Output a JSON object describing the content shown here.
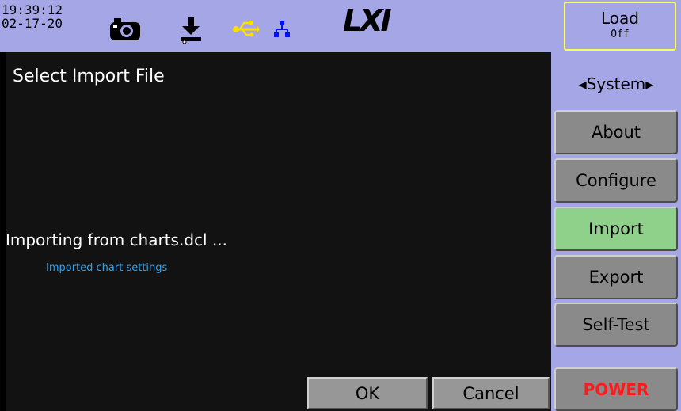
{
  "status_bar": {
    "time": "19:39:12",
    "date": "02-17-20",
    "logo": "LXI",
    "icons": [
      "camera-icon",
      "download-icon",
      "usb-icon",
      "network-icon"
    ],
    "colors": {
      "usb": "#ffe000",
      "network": "#0010ff"
    }
  },
  "main": {
    "title": "Select Import File",
    "status": "Importing from charts.dcl ...",
    "detail": "Imported chart settings",
    "ok_label": "OK",
    "cancel_label": "Cancel"
  },
  "side": {
    "load_label": "Load",
    "load_state": "Off",
    "menu_title": "◂System▸",
    "buttons": [
      "About",
      "Configure",
      "Import",
      "Export",
      "Self-Test"
    ],
    "active": "Import",
    "active_color": "#8fd18a",
    "power_label": "POWER",
    "power_color": "#ff1a1a"
  }
}
